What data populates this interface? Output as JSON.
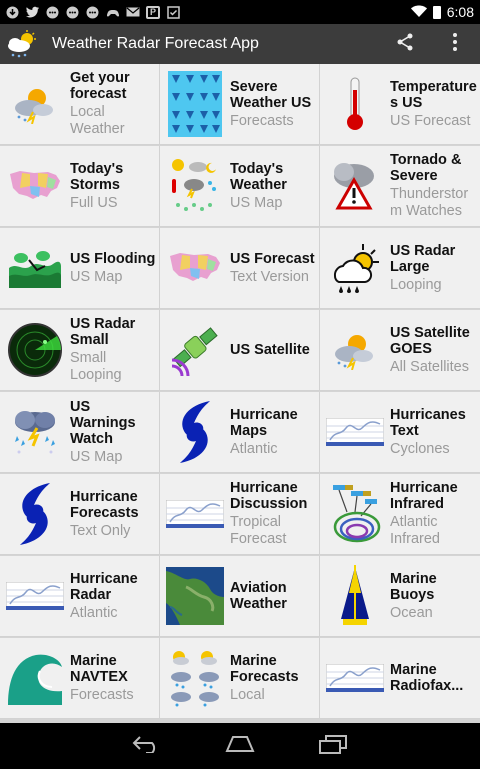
{
  "status_bar": {
    "time": "6:08",
    "notification_icons": [
      "download-icon",
      "twitter-icon",
      "message-icon",
      "message-icon",
      "message-icon",
      "gamepad-icon",
      "mail-icon",
      "parking-icon",
      "check-icon"
    ]
  },
  "action_bar": {
    "title": "Weather Radar Forecast App",
    "actions": [
      "share-icon",
      "overflow-menu-icon"
    ]
  },
  "grid": [
    [
      {
        "title": "Get your forecast",
        "sub": "Local Weather",
        "icon": "sun-cloud-lightning-icon"
      },
      {
        "title": "Severe Weather US",
        "sub": "Forecasts",
        "icon": "severe-weather-icon"
      },
      {
        "title": "Temperature s US",
        "sub": "US Forecast",
        "icon": "thermometer-icon"
      }
    ],
    [
      {
        "title": "Today's Storms",
        "sub": "Full US",
        "icon": "us-map-icon"
      },
      {
        "title": "Today's Weather",
        "sub": "US Map",
        "icon": "weather-symbols-icon"
      },
      {
        "title": "Tornado & Severe",
        "sub": "Thunderstor m Watches",
        "icon": "warning-cloud-icon"
      }
    ],
    [
      {
        "title": "US Flooding",
        "sub": "US Map",
        "icon": "flood-icon"
      },
      {
        "title": "US Forecast",
        "sub": "Text Version",
        "icon": "us-map-icon"
      },
      {
        "title": "US Radar Large",
        "sub": "Looping",
        "icon": "sun-rain-icon"
      }
    ],
    [
      {
        "title": "US Radar Small",
        "sub": "Small Looping",
        "icon": "radar-icon"
      },
      {
        "title": "US Satellite",
        "sub": "",
        "icon": "satellite-icon"
      },
      {
        "title": "US Satellite GOES",
        "sub": "All Satellites",
        "icon": "sun-cloud-lightning-icon"
      }
    ],
    [
      {
        "title": "US Warnings Watch",
        "sub": "US Map",
        "icon": "storm-cloud-icon"
      },
      {
        "title": "Hurricane Maps",
        "sub": "Atlantic",
        "icon": "hurricane-icon"
      },
      {
        "title": "Hurricanes Text",
        "sub": "Cyclones",
        "icon": "chart-strip-icon"
      }
    ],
    [
      {
        "title": "Hurricane Forecasts",
        "sub": "Text Only",
        "icon": "hurricane-icon"
      },
      {
        "title": "Hurricane Discussion",
        "sub": "Tropical Forecast",
        "icon": "chart-strip-icon"
      },
      {
        "title": "Hurricane Infrared",
        "sub": "Atlantic Infrared",
        "icon": "infrared-track-icon"
      }
    ],
    [
      {
        "title": "Hurricane Radar",
        "sub": "Atlantic",
        "icon": "chart-strip-icon"
      },
      {
        "title": "Aviation Weather",
        "sub": "",
        "icon": "aerial-map-icon"
      },
      {
        "title": "Marine Buoys",
        "sub": "Ocean",
        "icon": "buoy-icon"
      }
    ],
    [
      {
        "title": "Marine NAVTEX",
        "sub": "Forecasts",
        "icon": "wave-icon"
      },
      {
        "title": "Marine Forecasts",
        "sub": "Local",
        "icon": "forecast-grid-icon"
      },
      {
        "title": "Marine Radiofax...",
        "sub": "",
        "icon": "chart-strip-icon"
      }
    ]
  ],
  "nav_bar": [
    "back-icon",
    "home-icon",
    "recent-apps-icon"
  ]
}
